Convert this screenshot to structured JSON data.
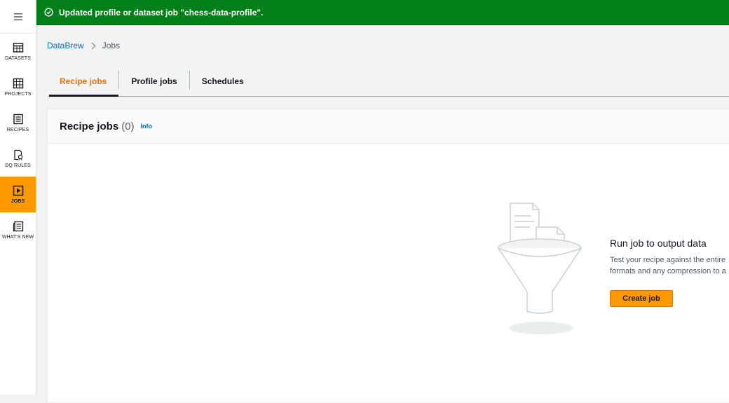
{
  "flash": {
    "message": "Updated profile or dataset job \"chess-data-profile\".",
    "color": "#03801a"
  },
  "rail": {
    "menu_icon": "hamburger-icon",
    "items": [
      {
        "label": "DATASETS",
        "icon": "table-icon",
        "active": false
      },
      {
        "label": "PROJECTS",
        "icon": "grid-icon",
        "active": false
      },
      {
        "label": "RECIPES",
        "icon": "list-icon",
        "active": false
      },
      {
        "label": "DQ RULES",
        "icon": "rules-icon",
        "active": false
      },
      {
        "label": "JOBS",
        "icon": "play-icon",
        "active": true
      },
      {
        "label": "WHAT'S NEW",
        "icon": "news-icon",
        "active": false
      }
    ]
  },
  "breadcrumb": {
    "root": "DataBrew",
    "current": "Jobs"
  },
  "tabs": [
    {
      "label": "Recipe jobs",
      "active": true
    },
    {
      "label": "Profile jobs",
      "active": false
    },
    {
      "label": "Schedules",
      "active": false
    }
  ],
  "container": {
    "title": "Recipe jobs",
    "count": "(0)",
    "info": "Info"
  },
  "empty_state": {
    "title": "Run job to output data",
    "desc_line1": "Test your recipe against the entire",
    "desc_line2": "formats and any compression to a",
    "button": "Create job",
    "illustration": "funnel-documents-illustration"
  },
  "colors": {
    "accent": "#ff9900",
    "active_tab": "#ec7211",
    "link": "#0073bb"
  }
}
